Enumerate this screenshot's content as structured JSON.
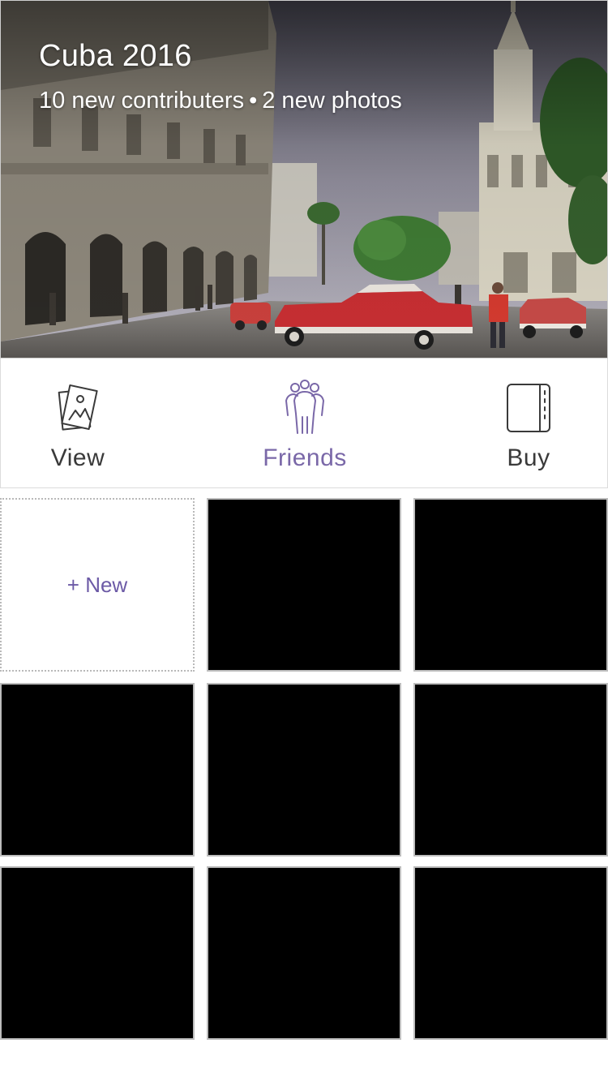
{
  "album": {
    "title": "Cuba 2016",
    "contributors": "10 new contributers",
    "separator": "•",
    "photos": "2 new photos"
  },
  "actions": {
    "view": {
      "label": "View",
      "icon": "photo-stack-icon"
    },
    "friends": {
      "label": "Friends",
      "icon": "friends-group-icon",
      "active": true
    },
    "buy": {
      "label": "Buy",
      "icon": "book-icon"
    }
  },
  "grid": {
    "new_label": "+ New",
    "photo_count": 8
  },
  "colors": {
    "accent": "#7a68a8",
    "text": "#3a3a3a",
    "tile": "#000000"
  }
}
